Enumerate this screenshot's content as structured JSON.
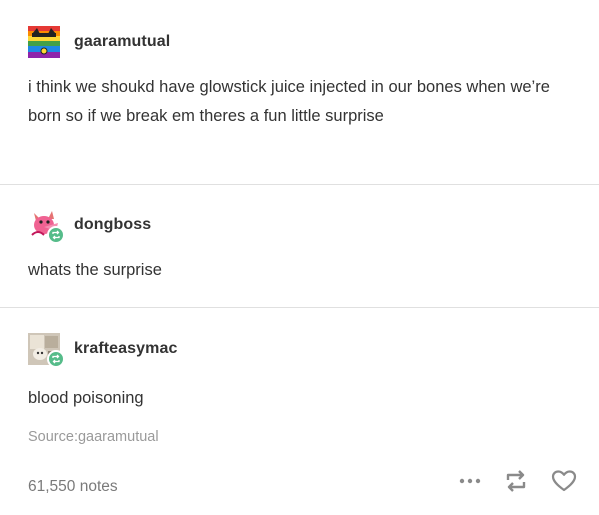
{
  "posts": [
    {
      "username": "gaaramutual",
      "text": "i think we shoukd have glowstick juice injected in our bones when we’re born so if we break em theres a fun little surprise",
      "avatar_icon": "rainbow-cat-avatar-icon"
    },
    {
      "username": "dongboss",
      "text": "whats the surprise",
      "avatar_icon": "pink-dog-avatar-icon"
    },
    {
      "username": "krafteasymac",
      "text": "blood poisoning",
      "avatar_icon": "comic-avatar-icon"
    }
  ],
  "footer": {
    "source": "Source:gaaramutual",
    "notes": "61,550 notes"
  },
  "colors": {
    "reblog_green": "#56bc8a",
    "divider": "#e0e0e0"
  }
}
